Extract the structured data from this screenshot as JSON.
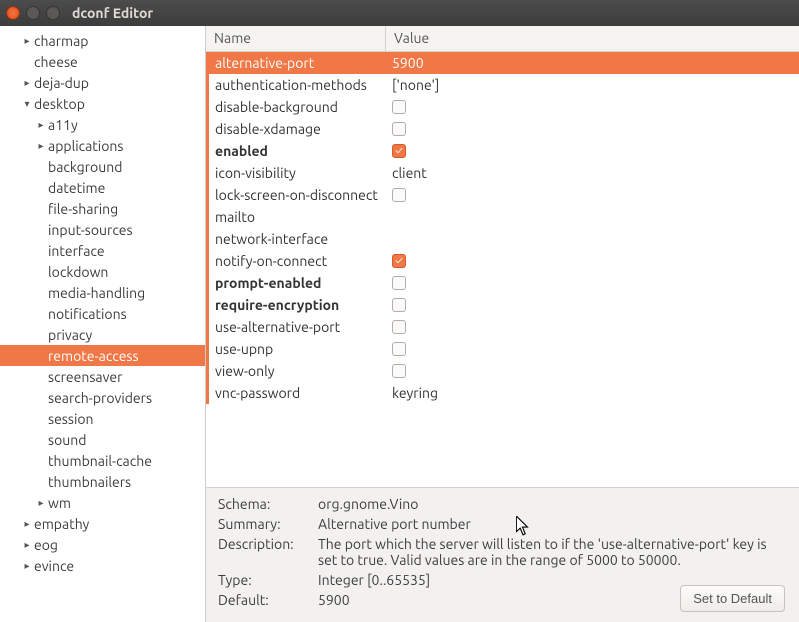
{
  "window": {
    "title": "dconf Editor"
  },
  "sidebar": {
    "items": [
      {
        "label": "charmap",
        "depth": 1,
        "tri": "▸",
        "selected": false
      },
      {
        "label": "cheese",
        "depth": 1,
        "tri": "",
        "selected": false
      },
      {
        "label": "deja-dup",
        "depth": 1,
        "tri": "▸",
        "selected": false
      },
      {
        "label": "desktop",
        "depth": 1,
        "tri": "▾",
        "selected": false
      },
      {
        "label": "a11y",
        "depth": 2,
        "tri": "▸",
        "selected": false
      },
      {
        "label": "applications",
        "depth": 2,
        "tri": "▸",
        "selected": false
      },
      {
        "label": "background",
        "depth": 2,
        "tri": "",
        "selected": false
      },
      {
        "label": "datetime",
        "depth": 2,
        "tri": "",
        "selected": false
      },
      {
        "label": "file-sharing",
        "depth": 2,
        "tri": "",
        "selected": false
      },
      {
        "label": "input-sources",
        "depth": 2,
        "tri": "",
        "selected": false
      },
      {
        "label": "interface",
        "depth": 2,
        "tri": "",
        "selected": false
      },
      {
        "label": "lockdown",
        "depth": 2,
        "tri": "",
        "selected": false
      },
      {
        "label": "media-handling",
        "depth": 2,
        "tri": "",
        "selected": false
      },
      {
        "label": "notifications",
        "depth": 2,
        "tri": "",
        "selected": false
      },
      {
        "label": "privacy",
        "depth": 2,
        "tri": "",
        "selected": false
      },
      {
        "label": "remote-access",
        "depth": 2,
        "tri": "",
        "selected": true
      },
      {
        "label": "screensaver",
        "depth": 2,
        "tri": "",
        "selected": false
      },
      {
        "label": "search-providers",
        "depth": 2,
        "tri": "",
        "selected": false
      },
      {
        "label": "session",
        "depth": 2,
        "tri": "",
        "selected": false
      },
      {
        "label": "sound",
        "depth": 2,
        "tri": "",
        "selected": false
      },
      {
        "label": "thumbnail-cache",
        "depth": 2,
        "tri": "",
        "selected": false
      },
      {
        "label": "thumbnailers",
        "depth": 2,
        "tri": "",
        "selected": false
      },
      {
        "label": "wm",
        "depth": 2,
        "tri": "▸",
        "selected": false
      },
      {
        "label": "empathy",
        "depth": 1,
        "tri": "▸",
        "selected": false
      },
      {
        "label": "eog",
        "depth": 1,
        "tri": "▸",
        "selected": false
      },
      {
        "label": "evince",
        "depth": 1,
        "tri": "▸",
        "selected": false
      }
    ]
  },
  "list": {
    "headers": {
      "name": "Name",
      "value": "Value"
    },
    "rows": [
      {
        "name": "alternative-port",
        "value": "5900",
        "type": "text",
        "selected": true,
        "bold": false
      },
      {
        "name": "authentication-methods",
        "value": "['none']",
        "type": "text",
        "selected": false,
        "bold": false
      },
      {
        "name": "disable-background",
        "value": "",
        "type": "check",
        "checked": false,
        "selected": false,
        "bold": false
      },
      {
        "name": "disable-xdamage",
        "value": "",
        "type": "check",
        "checked": false,
        "selected": false,
        "bold": false
      },
      {
        "name": "enabled",
        "value": "",
        "type": "check",
        "checked": true,
        "selected": false,
        "bold": true
      },
      {
        "name": "icon-visibility",
        "value": "client",
        "type": "text",
        "selected": false,
        "bold": false
      },
      {
        "name": "lock-screen-on-disconnect",
        "value": "",
        "type": "check",
        "checked": false,
        "selected": false,
        "bold": false
      },
      {
        "name": "mailto",
        "value": "",
        "type": "text",
        "selected": false,
        "bold": false
      },
      {
        "name": "network-interface",
        "value": "",
        "type": "text",
        "selected": false,
        "bold": false
      },
      {
        "name": "notify-on-connect",
        "value": "",
        "type": "check",
        "checked": true,
        "selected": false,
        "bold": false
      },
      {
        "name": "prompt-enabled",
        "value": "",
        "type": "check",
        "checked": false,
        "selected": false,
        "bold": true
      },
      {
        "name": "require-encryption",
        "value": "",
        "type": "check",
        "checked": false,
        "selected": false,
        "bold": true
      },
      {
        "name": "use-alternative-port",
        "value": "",
        "type": "check",
        "checked": false,
        "selected": false,
        "bold": false
      },
      {
        "name": "use-upnp",
        "value": "",
        "type": "check",
        "checked": false,
        "selected": false,
        "bold": false
      },
      {
        "name": "view-only",
        "value": "",
        "type": "check",
        "checked": false,
        "selected": false,
        "bold": false
      },
      {
        "name": "vnc-password",
        "value": "keyring",
        "type": "text",
        "selected": false,
        "bold": false
      }
    ]
  },
  "details": {
    "labels": {
      "schema": "Schema:",
      "summary": "Summary:",
      "description": "Description:",
      "type": "Type:",
      "default": "Default:"
    },
    "schema": "org.gnome.Vino",
    "summary": "Alternative port number",
    "description": "The port which the server will listen to if the 'use-alternative-port' key is set to true. Valid values are in the range of 5000 to 50000.",
    "type": "Integer [0..65535]",
    "default": "5900",
    "set_default": "Set to Default"
  }
}
